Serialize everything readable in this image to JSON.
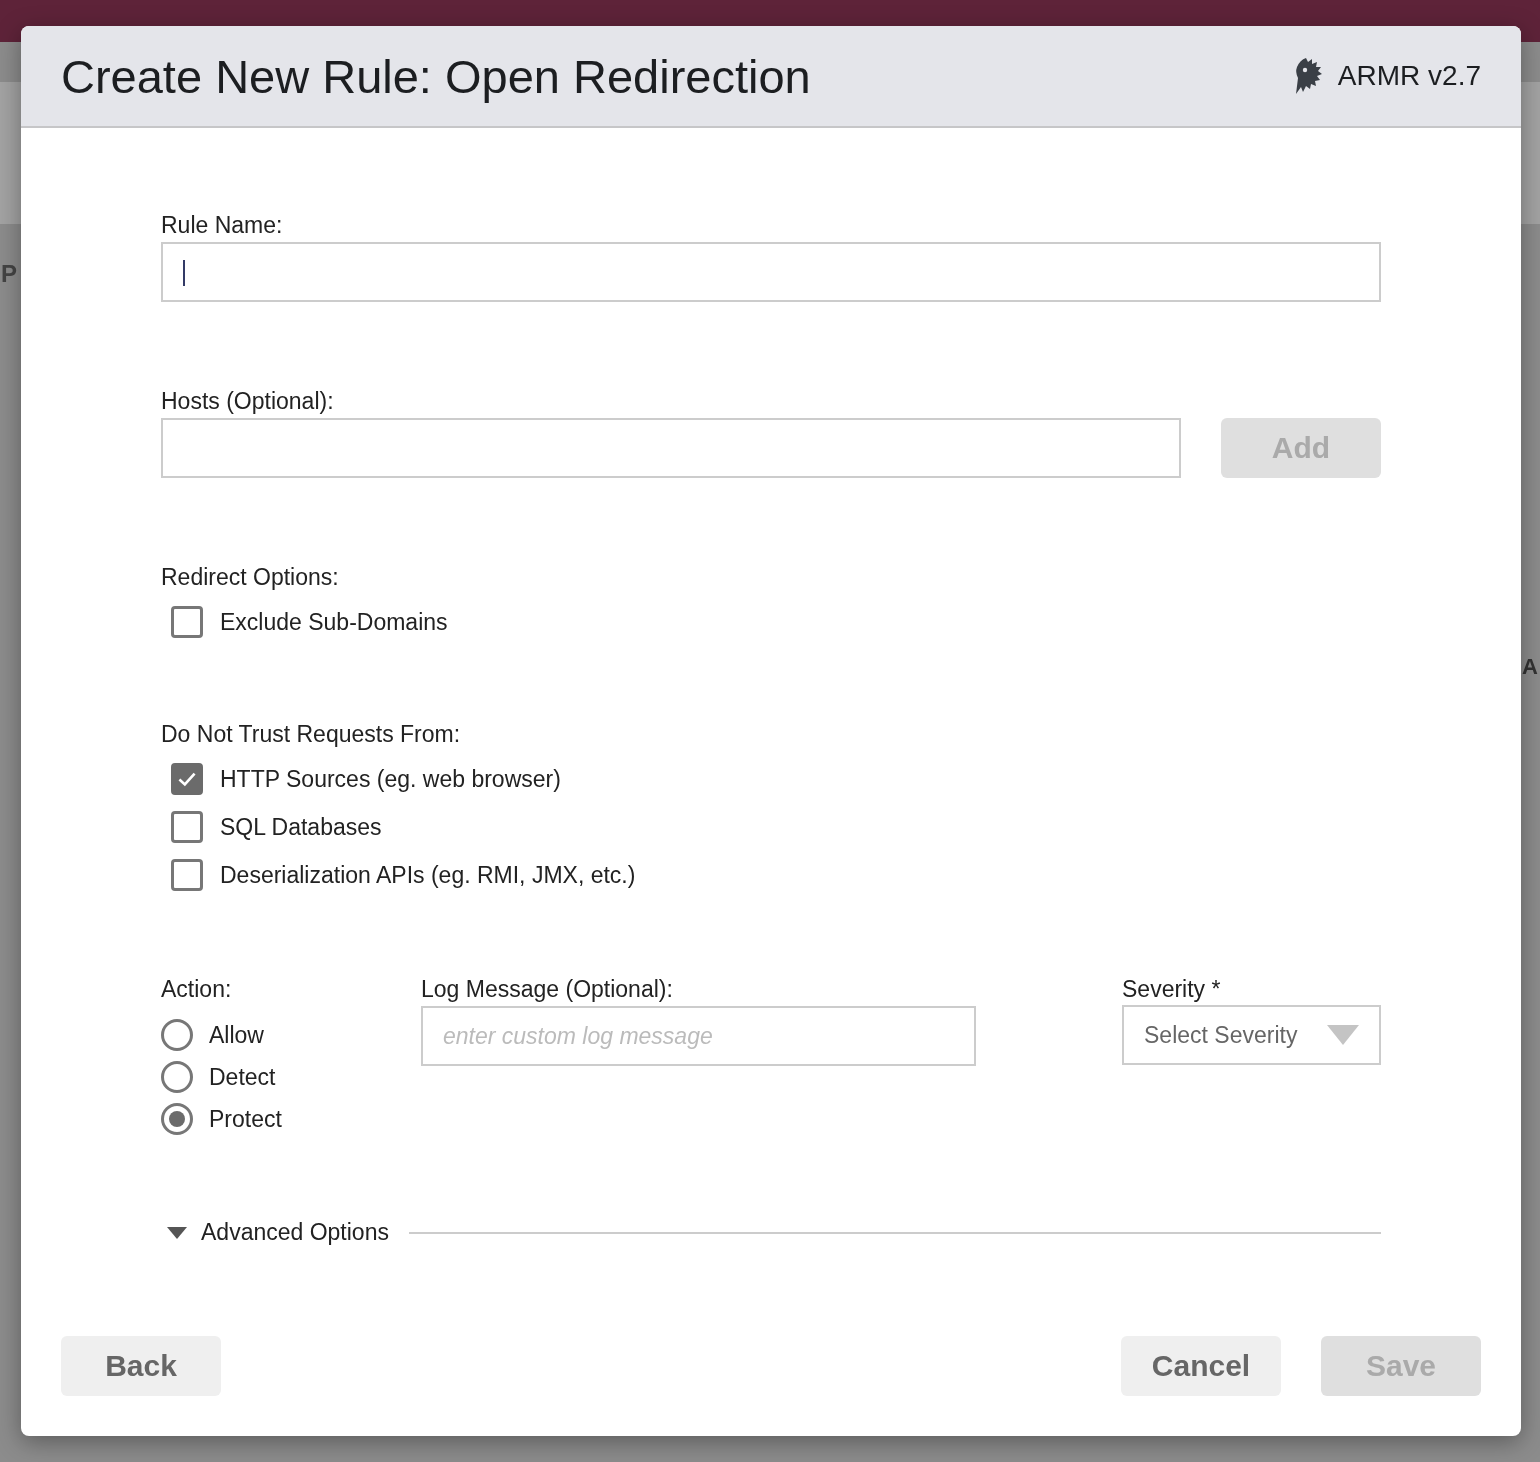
{
  "background": {
    "left_text": "P",
    "right_text": "A"
  },
  "dialog": {
    "title": "Create New Rule: Open Redirection",
    "brand": "ARMR v2.7"
  },
  "rule_name": {
    "label": "Rule Name:",
    "focused": true
  },
  "hosts": {
    "label": "Hosts (Optional):",
    "button": {
      "label": "Add",
      "disabled": true
    }
  },
  "redirect_options": {
    "label": "Redirect Options:",
    "options": [
      {
        "label": "Exclude Sub-Domains",
        "checked": false
      }
    ]
  },
  "untrusted_sources": {
    "label": "Do Not Trust Requests From:",
    "options": [
      {
        "label": "HTTP Sources (eg. web browser)",
        "checked": true
      },
      {
        "label": "SQL Databases",
        "checked": false
      },
      {
        "label": "Deserialization APIs (eg. RMI, JMX, etc.)",
        "checked": false
      }
    ]
  },
  "action": {
    "label": "Action:",
    "options": [
      {
        "label": "Allow",
        "selected": false
      },
      {
        "label": "Detect",
        "selected": false
      },
      {
        "label": "Protect",
        "selected": true
      }
    ]
  },
  "log_message": {
    "label": "Log Message (Optional):",
    "placeholder": "enter custom log message"
  },
  "severity": {
    "label": "Severity *",
    "placeholder": "Select Severity"
  },
  "advanced": {
    "label": "Advanced Options"
  },
  "footer": {
    "left_buttons": [
      {
        "label": "Back",
        "disabled": false
      }
    ],
    "right_buttons": [
      {
        "label": "Cancel",
        "disabled": false
      },
      {
        "label": "Save",
        "disabled": true
      }
    ]
  }
}
